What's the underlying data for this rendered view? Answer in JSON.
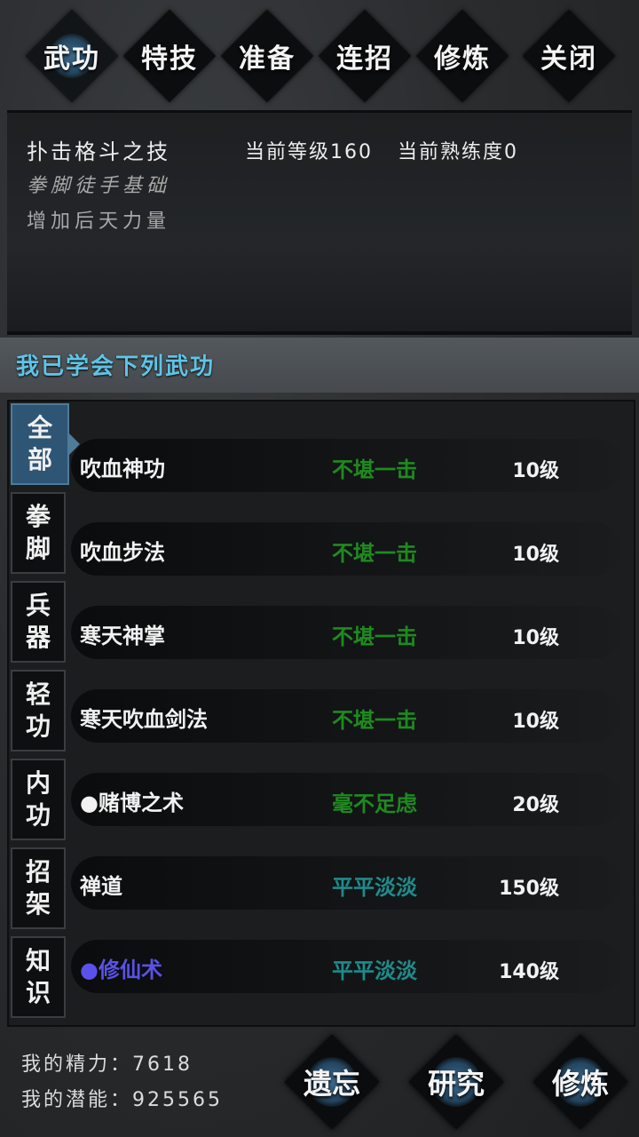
{
  "tabs": [
    "武功",
    "特技",
    "准备",
    "连招",
    "修炼",
    "关闭"
  ],
  "info": {
    "skill_name": "扑击格斗之技",
    "level_label": "当前等级160",
    "proficiency_label": "当前熟练度0",
    "category": "拳脚徒手基础",
    "description": "增加后天力量"
  },
  "learned_header": "我已学会下列武功",
  "side_tabs": [
    {
      "top": "全",
      "bottom": "部"
    },
    {
      "top": "拳",
      "bottom": "脚"
    },
    {
      "top": "兵",
      "bottom": "器"
    },
    {
      "top": "轻",
      "bottom": "功"
    },
    {
      "top": "内",
      "bottom": "功"
    },
    {
      "top": "招",
      "bottom": "架"
    },
    {
      "top": "知",
      "bottom": "识"
    }
  ],
  "skills": [
    {
      "name": "吹血神功",
      "rating": "不堪一击",
      "level": "10级"
    },
    {
      "name": "吹血步法",
      "rating": "不堪一击",
      "level": "10级"
    },
    {
      "name": "寒天神掌",
      "rating": "不堪一击",
      "level": "10级"
    },
    {
      "name": "寒天吹血剑法",
      "rating": "不堪一击",
      "level": "10级"
    },
    {
      "name": "●赌博之术",
      "rating": "毫不足虑",
      "level": "20级"
    },
    {
      "name": "禅道",
      "rating": "平平淡淡",
      "level": "150级"
    },
    {
      "name": "●修仙术",
      "rating": "平平淡淡",
      "level": "140级"
    }
  ],
  "colors": {
    "rating_green": "#1f8a1f",
    "rating_teal": "#1f8b8b",
    "accent_blue": "#5fc4e6",
    "highlight_name": "#5a52e8"
  },
  "stats": {
    "energy": "我的精力：7618",
    "potential": "我的潜能：925565"
  },
  "bottom_buttons": [
    "遗忘",
    "研究",
    "修炼"
  ]
}
